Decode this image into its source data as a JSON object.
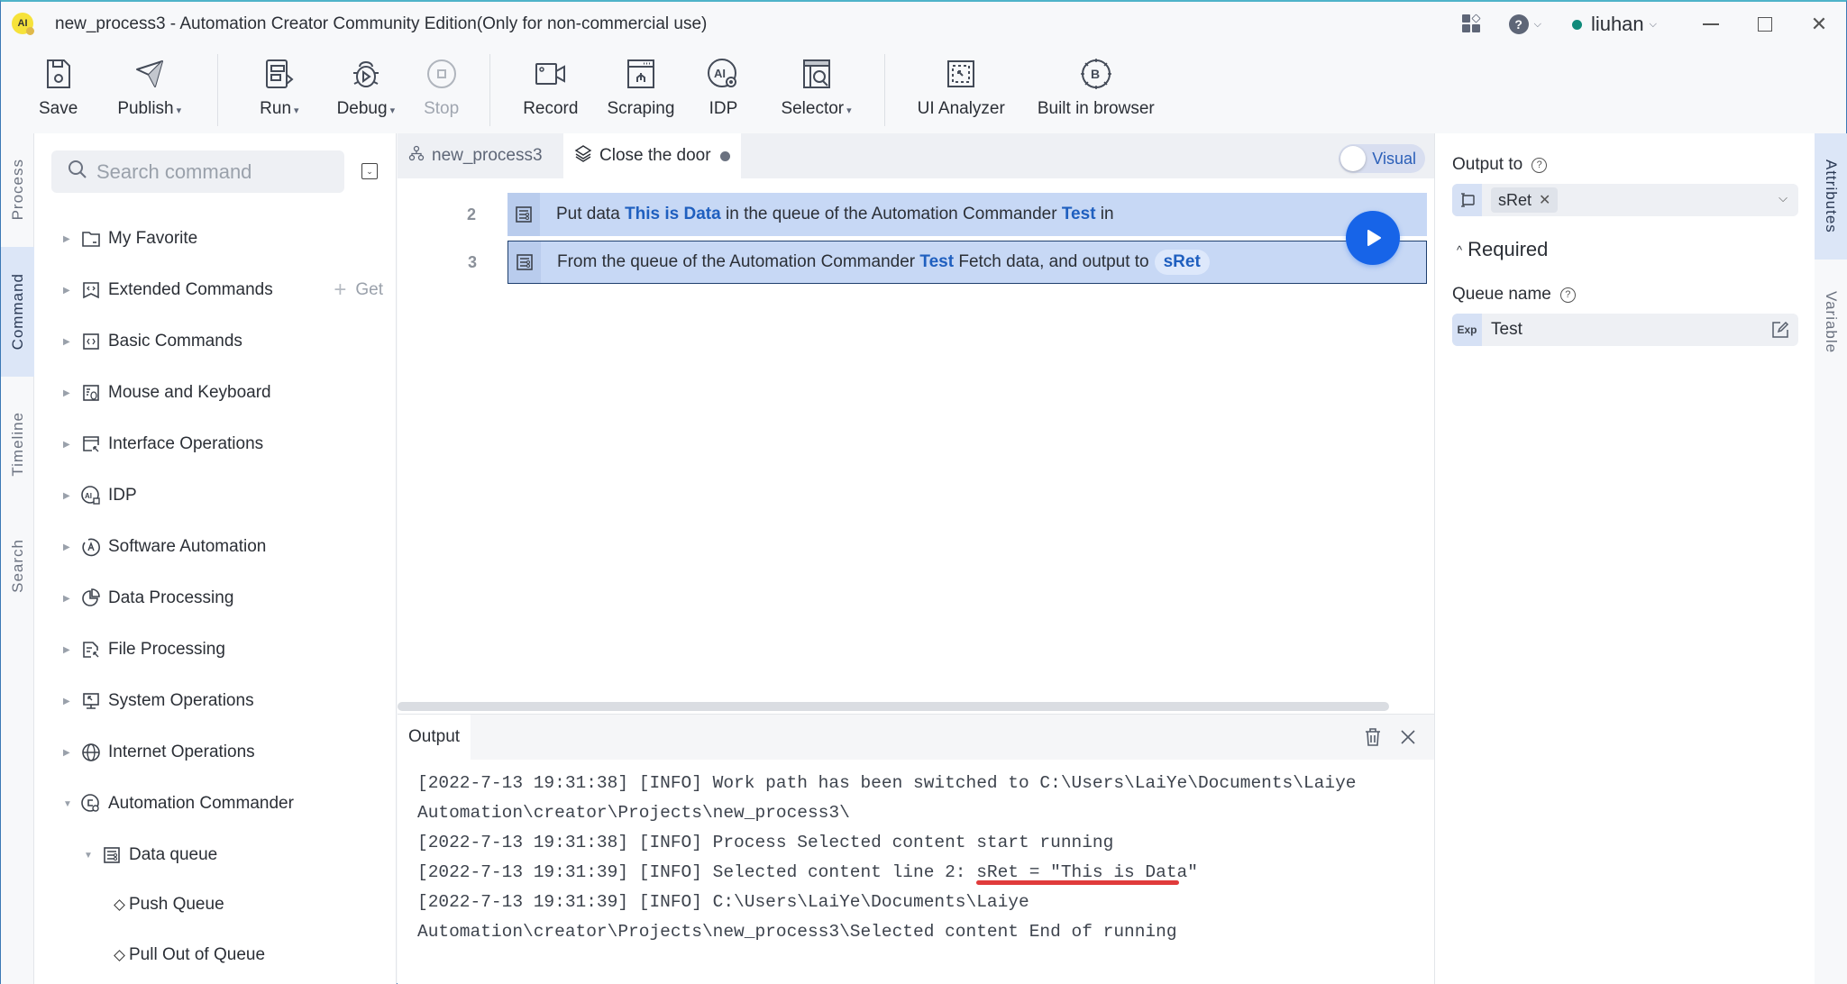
{
  "window": {
    "title": "new_process3 - Automation Creator Community Edition(Only for non-commercial use)",
    "logo_text": "AI",
    "user": "liuhan",
    "user_status_color": "#0f8a7a",
    "help_label": "?"
  },
  "toolbar": {
    "items": [
      {
        "label": "Save",
        "icon": "save-icon"
      },
      {
        "label": "Publish",
        "icon": "publish-icon",
        "dropdown": true
      },
      {
        "label": "Run",
        "icon": "run-icon",
        "dropdown": true
      },
      {
        "label": "Debug",
        "icon": "debug-icon",
        "dropdown": true
      },
      {
        "label": "Stop",
        "icon": "stop-icon",
        "disabled": true
      },
      {
        "label": "Record",
        "icon": "record-icon"
      },
      {
        "label": "Scraping",
        "icon": "scraping-icon"
      },
      {
        "label": "IDP",
        "icon": "idp-icon"
      },
      {
        "label": "Selector",
        "icon": "selector-icon",
        "dropdown": true
      },
      {
        "label": "UI Analyzer",
        "icon": "ui-analyzer-icon"
      },
      {
        "label": "Built in browser",
        "icon": "browser-icon"
      }
    ],
    "caret": "▾"
  },
  "left_tabs": [
    {
      "label": "Process",
      "active": false
    },
    {
      "label": "Command",
      "active": true
    },
    {
      "label": "Timeline",
      "active": false
    },
    {
      "label": "Search",
      "active": false
    }
  ],
  "command_panel": {
    "search_placeholder": "Search command",
    "get_label": "Get",
    "tree": [
      {
        "label": "My Favorite",
        "icon": "folder-icon",
        "expanded": false
      },
      {
        "label": "Extended Commands",
        "icon": "extended-commands-icon",
        "expanded": false
      },
      {
        "label": "Basic Commands",
        "icon": "basic-commands-icon",
        "expanded": false
      },
      {
        "label": "Mouse and Keyboard",
        "icon": "mouse-keyboard-icon",
        "expanded": false
      },
      {
        "label": "Interface Operations",
        "icon": "interface-operations-icon",
        "expanded": false
      },
      {
        "label": "IDP",
        "icon": "idp-icon",
        "expanded": false
      },
      {
        "label": "Software Automation",
        "icon": "software-automation-icon",
        "expanded": false
      },
      {
        "label": "Data Processing",
        "icon": "pie-chart-icon",
        "expanded": false
      },
      {
        "label": "File Processing",
        "icon": "file-processing-icon",
        "expanded": false
      },
      {
        "label": "System Operations",
        "icon": "monitor-icon",
        "expanded": false
      },
      {
        "label": "Internet Operations",
        "icon": "globe-icon",
        "expanded": false
      },
      {
        "label": "Automation Commander",
        "icon": "commander-icon",
        "expanded": true
      },
      {
        "label": "Data queue",
        "icon": "queue-icon",
        "expanded": true
      },
      {
        "label": "Push Queue"
      },
      {
        "label": "Pull Out of Queue"
      }
    ]
  },
  "editor": {
    "tabs": [
      {
        "label": "new_process3",
        "active": false
      },
      {
        "label": "Close the door",
        "active": true,
        "unsaved": true
      }
    ],
    "visual_toggle": "Visual",
    "steps": [
      {
        "line": "2",
        "parts": [
          "Put data ",
          "This is Data",
          " in the queue of the Automation Commander ",
          "Test",
          " in"
        ]
      },
      {
        "line": "3",
        "parts": [
          "From the queue of the Automation Commander ",
          "Test",
          " Fetch data, and output to",
          "sRet"
        ],
        "selected": true
      }
    ]
  },
  "output": {
    "title": "Output",
    "log": [
      "[2022-7-13 19:31:38] [INFO] Work path has been switched to C:\\Users\\LaiYe\\Documents\\Laiye",
      "Automation\\creator\\Projects\\new_process3\\",
      "[2022-7-13 19:31:38] [INFO] Process Selected content start running",
      "[2022-7-13 19:31:39] [INFO] Selected content line 2: sRet = \"This is Data\"",
      "[2022-7-13 19:31:39] [INFO] C:\\Users\\LaiYe\\Documents\\Laiye",
      "Automation\\creator\\Projects\\new_process3\\Selected content End of running"
    ]
  },
  "attributes": {
    "output_to_label": "Output to",
    "output_to_value": "sRet",
    "required_label": "Required",
    "queue_name_label": "Queue name",
    "queue_name_prefix": "Exp",
    "queue_name_value": "Test"
  },
  "right_tabs": [
    {
      "label": "Attributes",
      "active": true
    },
    {
      "label": "Variable",
      "active": false
    }
  ],
  "colors": {
    "accent": "#1764e8",
    "step_bg": "#c7d8f5",
    "highlight_text": "#1f5fbf",
    "annotation_underline": "#e03b3b"
  }
}
